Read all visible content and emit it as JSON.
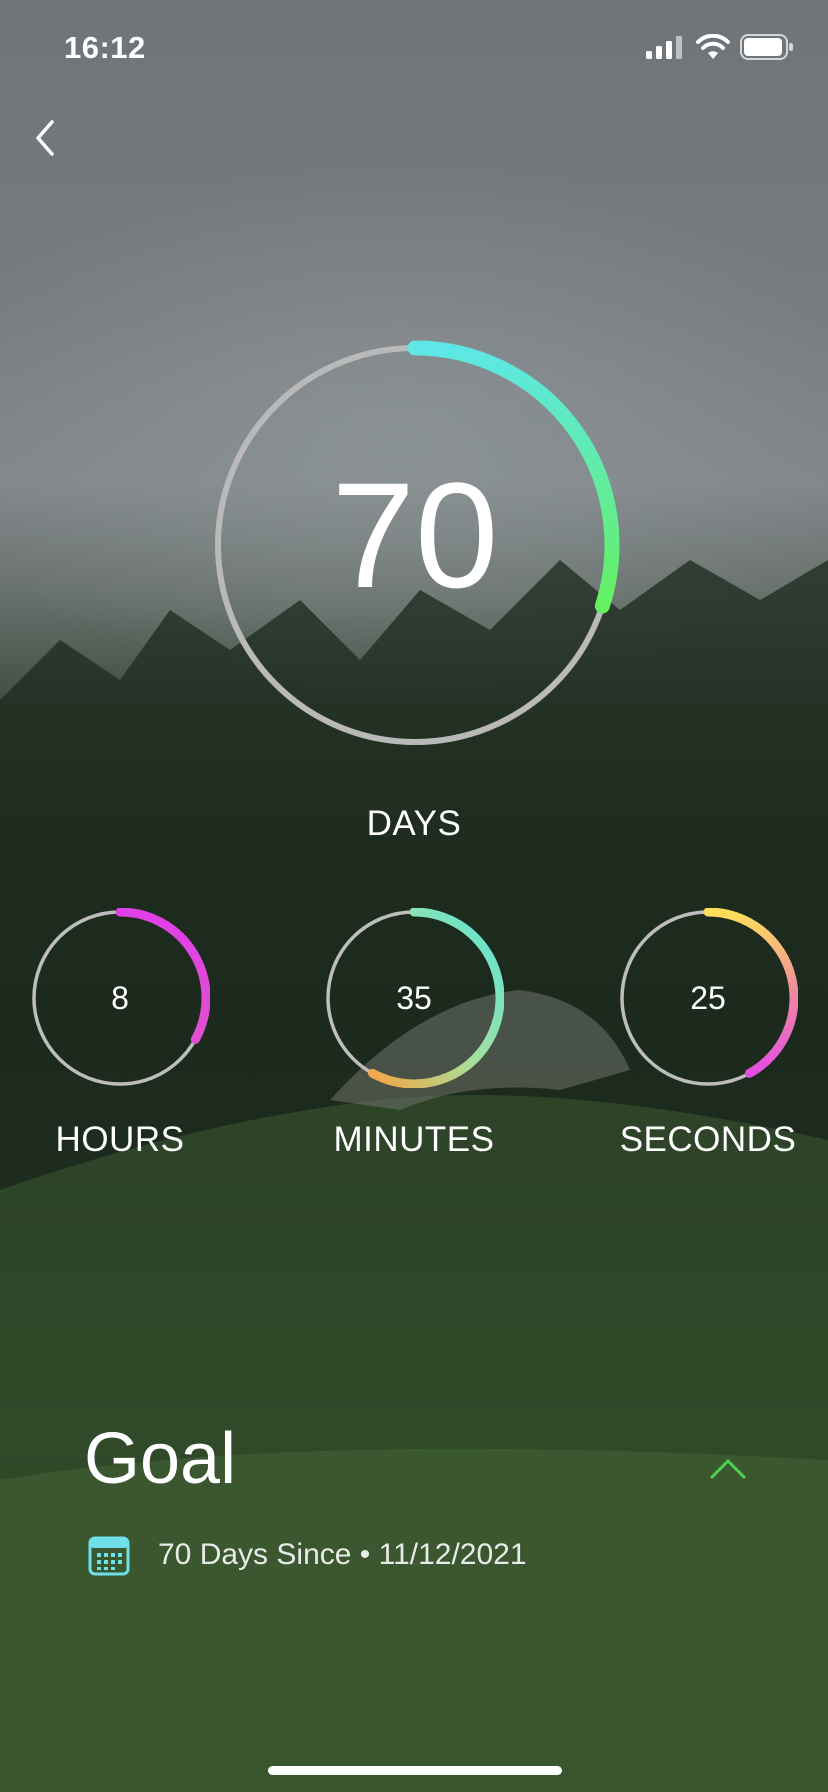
{
  "status_bar": {
    "time": "16:12"
  },
  "days": {
    "value": "70",
    "label": "DAYS",
    "progress": 0.3
  },
  "hours": {
    "value": "8",
    "label": "HOURS",
    "progress": 0.33
  },
  "minutes": {
    "value": "35",
    "label": "MINUTES",
    "progress": 0.58
  },
  "seconds": {
    "value": "25",
    "label": "SECONDS",
    "progress": 0.42
  },
  "goal": {
    "title": "Goal",
    "subtitle": "70 Days Since • 11/12/2021"
  },
  "colors": {
    "ring_track": "#b9b9b9",
    "days_gradient": [
      "#5ee7e6",
      "#64f060"
    ],
    "hours_gradient": [
      "#e040e8",
      "#e04fd0"
    ],
    "minutes_gradient": [
      "#58e6dc",
      "#f5a545"
    ],
    "seconds_gradient": [
      "#ffdf5a",
      "#e44ee0"
    ],
    "accent_green": "#4dd34f",
    "calendar_cyan": "#6fe0e8"
  },
  "icons": {
    "back": "chevron-left-icon",
    "signal": "cellular-signal-icon",
    "wifi": "wifi-icon",
    "battery": "battery-icon",
    "expand": "chevron-up-icon",
    "calendar": "calendar-icon"
  }
}
